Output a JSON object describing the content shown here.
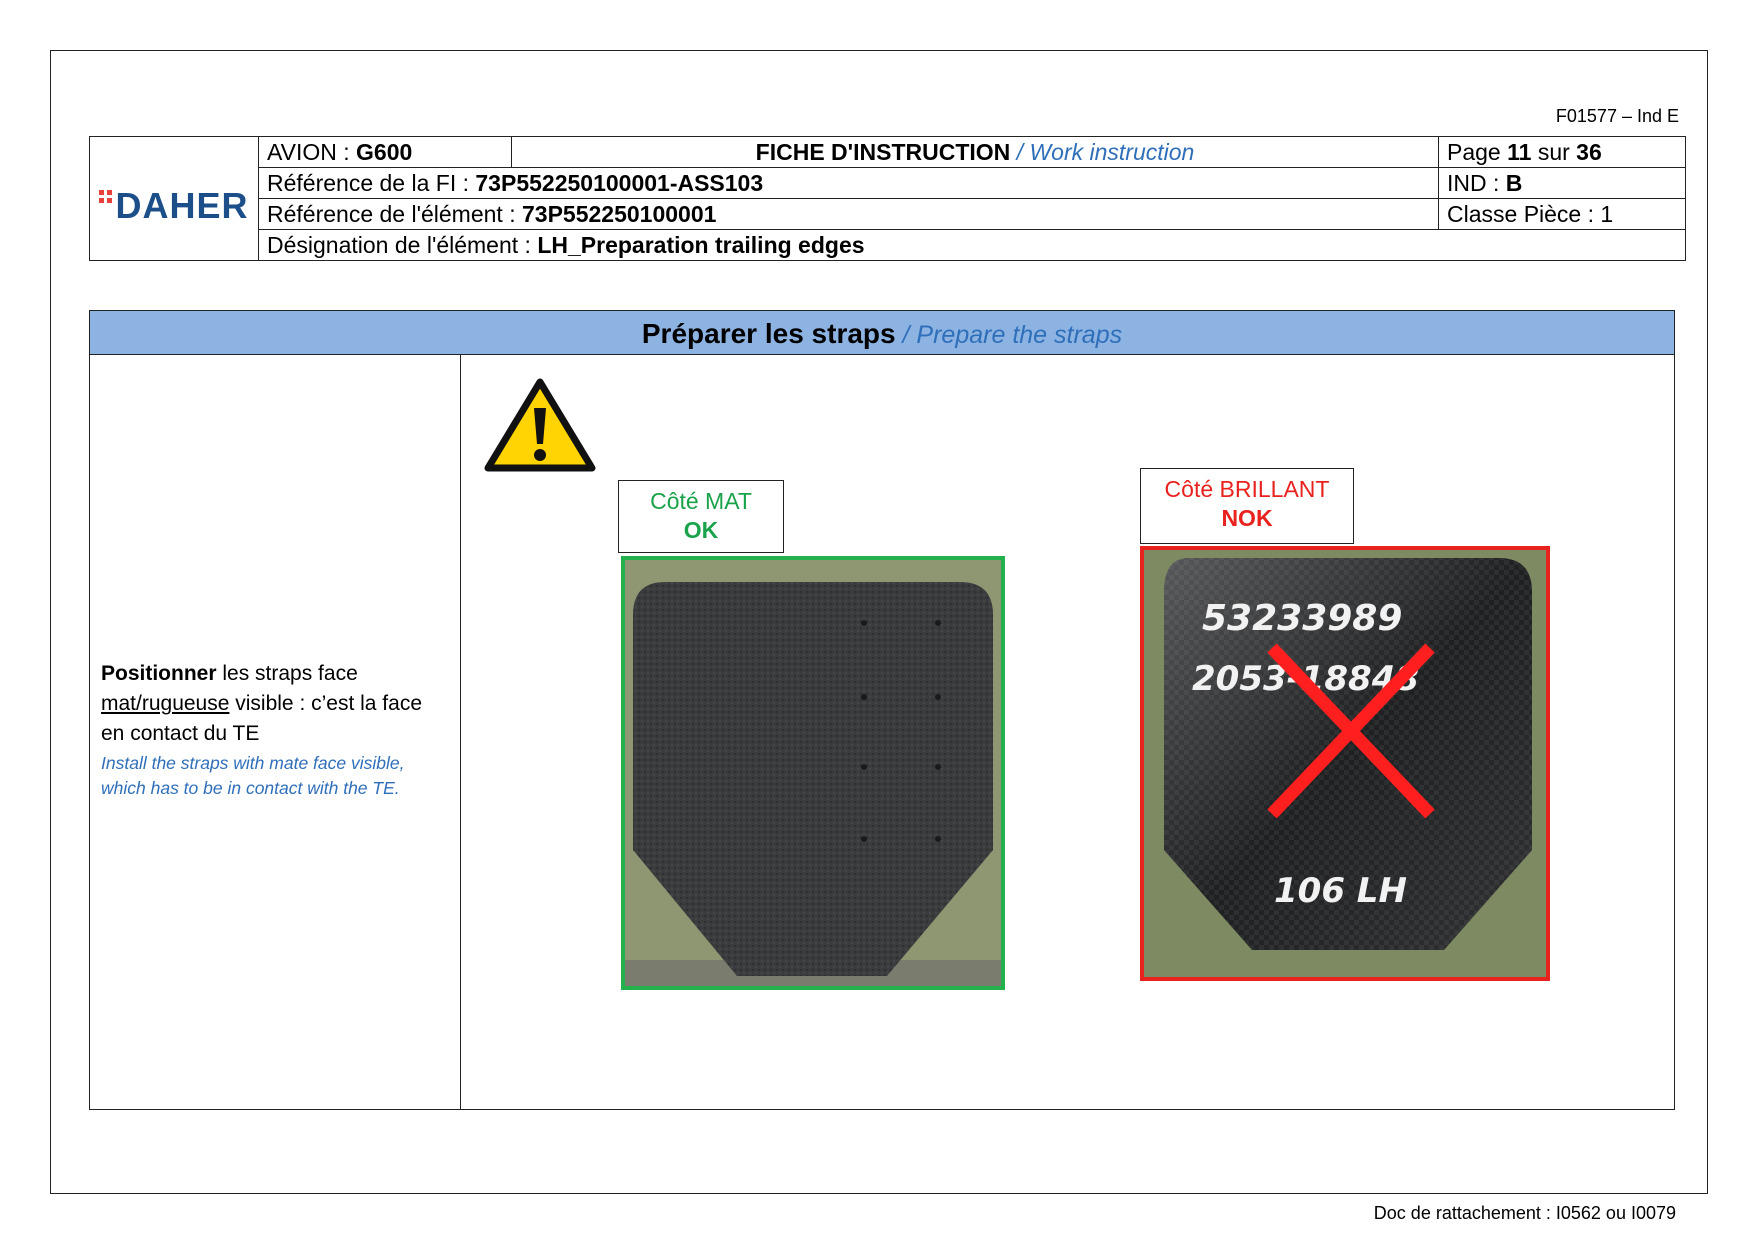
{
  "form_code": "F01577 – Ind E",
  "brand": {
    "name": "DAHER"
  },
  "header": {
    "avion_label": "AVION : ",
    "avion_value": "G600",
    "fiche_title": "FICHE D'INSTRUCTION",
    "fiche_subtitle": " / Work instruction",
    "page_label": "Page ",
    "page_current": "11",
    "page_sep": " sur ",
    "page_total": "36",
    "ref_fi_label": "Référence de la FI : ",
    "ref_fi_value": "73P552250100001-ASS103",
    "ind_label": "IND : ",
    "ind_value": "B",
    "ref_element_label": "Référence de l'élément : ",
    "ref_element_value": "73P552250100001",
    "classe_piece": "Classe Pièce : 1",
    "designation_label": "Désignation de l'élément : ",
    "designation_value": "LH_Preparation trailing edges"
  },
  "section": {
    "title_fr": "Préparer les straps",
    "title_en": " / Prepare the straps"
  },
  "instruction": {
    "bold": "Positionner",
    "text1": " les straps face ",
    "underlined": "mat/rugueuse",
    "text2": " visible : c’est la face en contact du TE",
    "english": "Install the straps with mate face visible, which has to be in contact with the TE."
  },
  "label_ok": {
    "line1": "Côté MAT",
    "line2": "OK"
  },
  "label_nok": {
    "line1": "Côté BRILLANT",
    "line2": "NOK"
  },
  "photo_nok_handwriting": {
    "line1": "53233989",
    "line2": "2053-18848",
    "line3": "106 LH"
  },
  "icons": {
    "warning": "warning-triangle-icon",
    "cross": "red-cross-icon"
  },
  "colors": {
    "accent_blue": "#2f6fba",
    "title_bar": "#8db3e2",
    "ok_green": "#22b14c",
    "nok_red": "#e8221f",
    "brand_blue": "#1c4f8a"
  },
  "footer": "Doc de rattachement : I0562 ou I0079"
}
